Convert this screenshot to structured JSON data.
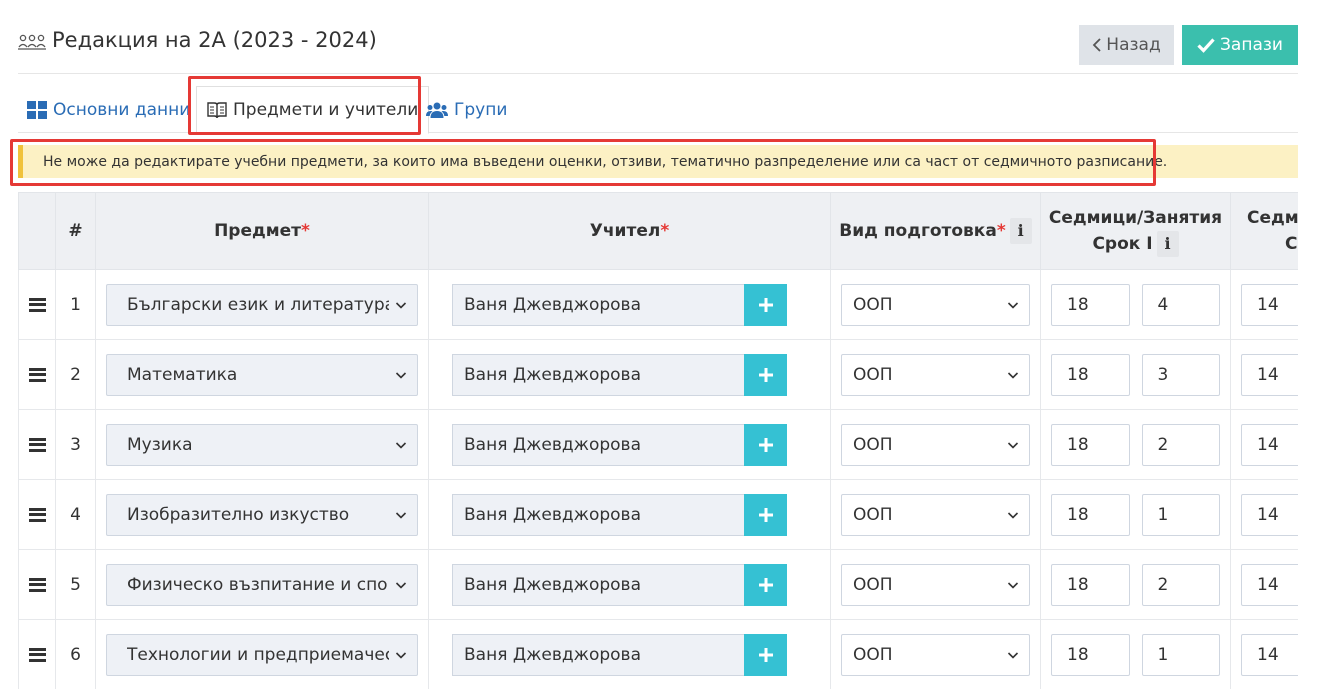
{
  "header": {
    "title": "Редакция на 2А (2023 - 2024)",
    "back_label": "Назад",
    "save_label": "Запази"
  },
  "tabs": [
    {
      "label": "Основни данни"
    },
    {
      "label": "Предмети и учители"
    },
    {
      "label": "Групи"
    }
  ],
  "alert": {
    "text": "Не може да редактирате учебни предмети, за които има въведени оценки, отзиви, тематично разпределение или са част от седмичното разписание."
  },
  "table": {
    "columns": {
      "num": "#",
      "subject": "Предмет",
      "teacher": "Учител",
      "prep": "Вид подготовка",
      "term1_line1": "Седмици/Занятия",
      "term1_line2": "Срок I",
      "term2_line1": "Седми",
      "term2_line2": "Ср",
      "required_mark": "*",
      "info_glyph": "i"
    },
    "rows": [
      {
        "num": "1",
        "subject": "Български език и литература",
        "teacher": "Ваня Джевджорова",
        "prep": "ООП",
        "weeks1": "18",
        "classes1": "4",
        "weeks2": "14"
      },
      {
        "num": "2",
        "subject": "Математика",
        "teacher": "Ваня Джевджорова",
        "prep": "ООП",
        "weeks1": "18",
        "classes1": "3",
        "weeks2": "14"
      },
      {
        "num": "3",
        "subject": "Музика",
        "teacher": "Ваня Джевджорова",
        "prep": "ООП",
        "weeks1": "18",
        "classes1": "2",
        "weeks2": "14"
      },
      {
        "num": "4",
        "subject": "Изобразително изкуство",
        "teacher": "Ваня Джевджорова",
        "prep": "ООП",
        "weeks1": "18",
        "classes1": "1",
        "weeks2": "14"
      },
      {
        "num": "5",
        "subject": "Физическо възпитание и спорт",
        "teacher": "Ваня Джевджорова",
        "prep": "ООП",
        "weeks1": "18",
        "classes1": "2",
        "weeks2": "14"
      },
      {
        "num": "6",
        "subject": "Технологии и предприемачество",
        "teacher": "Ваня Джевджорова",
        "prep": "ООП",
        "weeks1": "18",
        "classes1": "1",
        "weeks2": "14"
      }
    ]
  },
  "colors": {
    "accent_teal": "#3bbfad",
    "plus_cyan": "#35c1d3",
    "link_blue": "#2a6cb5",
    "highlight_red": "#e53935",
    "alert_bg": "#fcf1c4"
  },
  "icons": {
    "title": "class-group-icon",
    "back": "chevron-left-icon",
    "save": "check-icon",
    "tab1": "grid-icon",
    "tab2": "book-icon",
    "tab3": "users-icon"
  }
}
